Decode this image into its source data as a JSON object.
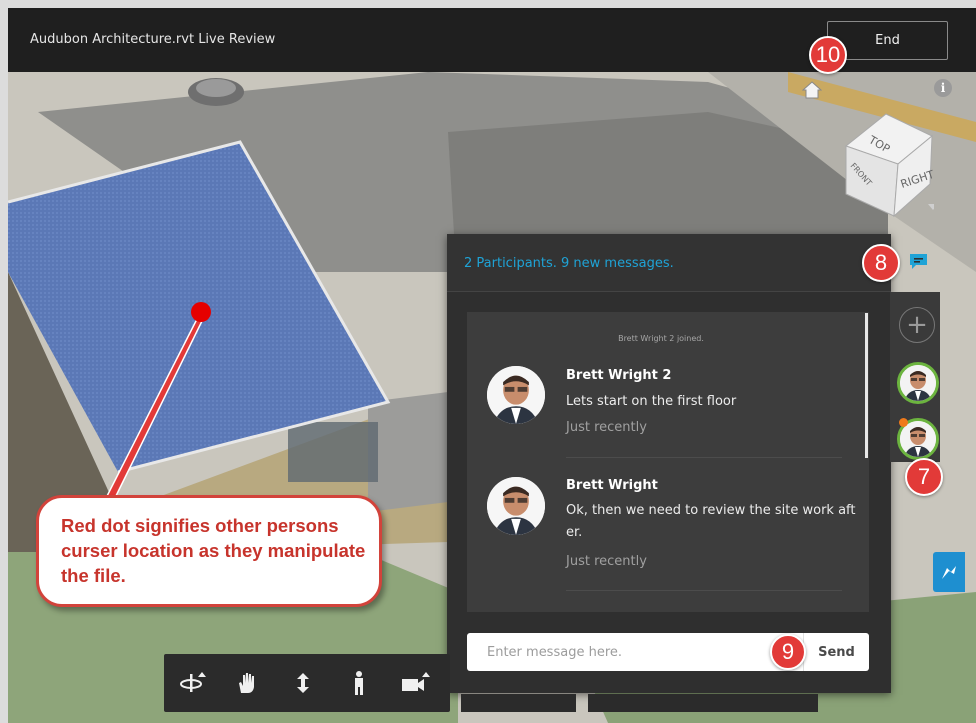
{
  "window": {
    "title": "Audubon Architecture.rvt Live Review",
    "end_label": "End"
  },
  "badges": {
    "b7": "7",
    "b8": "8",
    "b9": "9",
    "b10": "10"
  },
  "chat": {
    "header": "2 Participants. 9 new messages.",
    "add_symbol": "+",
    "system_message": "Brett Wright 2 joined.",
    "messages": [
      {
        "author": "Brett Wright 2",
        "text": "Lets start on the first floor",
        "time": "Just recently"
      },
      {
        "author": "Brett Wright",
        "text": "Ok, then we need to review the site work after.",
        "time": "Just recently"
      }
    ],
    "input_placeholder": "Enter message here.",
    "send_label": "Send"
  },
  "viewcube": {
    "top_label": "TOP",
    "front_label": "FRONT",
    "right_label": "RIGHT"
  },
  "info_symbol": "i",
  "callout": {
    "text": "Red dot signifies other persons curser location as they manipulate the file."
  },
  "toolbar": {
    "tools": [
      "orbit-icon",
      "pan-icon",
      "zoom-icon",
      "first-person-icon",
      "camera-icon"
    ]
  },
  "colors": {
    "accent": "#1fa3d6",
    "badge": "#e23a38",
    "cursor_dot": "#e60000",
    "online": "#6cb43f",
    "roof": "#5a78b8"
  }
}
